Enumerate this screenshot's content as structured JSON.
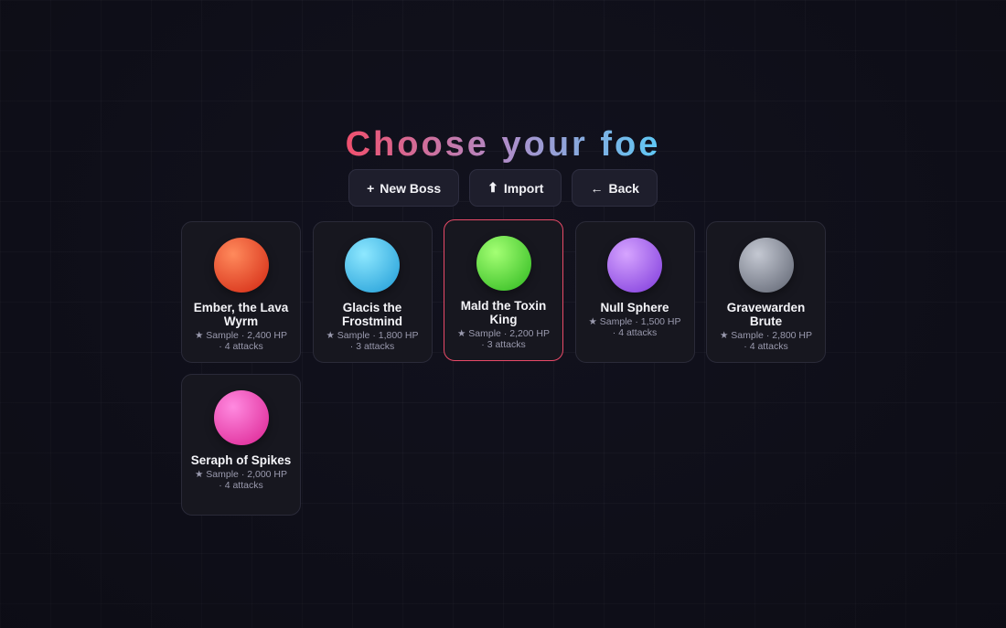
{
  "title": "Choose your foe",
  "toolbar": {
    "new_boss": {
      "icon": "+",
      "label": "New Boss"
    },
    "import": {
      "icon": "⬆",
      "label": "Import"
    },
    "back": {
      "icon": "←",
      "label": "Back"
    }
  },
  "bosses": [
    {
      "name": "Ember, the Lava Wyrm",
      "meta": "★ Sample · 2,400 HP · 4 attacks",
      "color_light": "#ff8a5c",
      "color_dark": "#d9351c",
      "selected": false
    },
    {
      "name": "Glacis the Frostmind",
      "meta": "★ Sample · 1,800 HP · 3 attacks",
      "color_light": "#8ee8ff",
      "color_dark": "#2ea6dc",
      "selected": false
    },
    {
      "name": "Mald the Toxin King",
      "meta": "★ Sample · 2,200 HP · 3 attacks",
      "color_light": "#a4ff74",
      "color_dark": "#3ec22a",
      "selected": true
    },
    {
      "name": "Null Sphere",
      "meta": "★ Sample · 1,500 HP · 4 attacks",
      "color_light": "#d6a4ff",
      "color_dark": "#8a48e0",
      "selected": false
    },
    {
      "name": "Gravewarden Brute",
      "meta": "★ Sample · 2,800 HP · 4 attacks",
      "color_light": "#c4c8d2",
      "color_dark": "#6c717e",
      "selected": false
    },
    {
      "name": "Seraph of Spikes",
      "meta": "★ Sample · 2,000 HP · 4 attacks",
      "color_light": "#ff8ae0",
      "color_dark": "#e0309c",
      "selected": false
    }
  ]
}
